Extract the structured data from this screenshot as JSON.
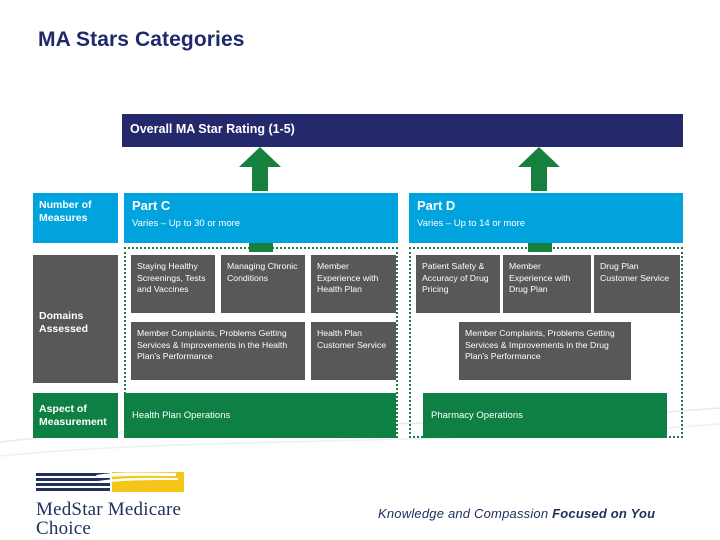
{
  "slide": {
    "title": "MA Stars Categories",
    "overall_bar": {
      "label": "Overall MA Star Rating (1-5)",
      "color": "#25286b"
    },
    "row_labels": [
      {
        "key": "measures",
        "label": "Number of Measures",
        "color": "#00a3dd"
      },
      {
        "key": "domains",
        "label": "Domains Assessed",
        "color": "#58585b"
      },
      {
        "key": "aspect",
        "label": "Aspect of Measurement",
        "color": "#0e8044"
      }
    ],
    "parts": {
      "part_c": {
        "name": "Part C",
        "measures": "Varies – Up to 30 or more",
        "domains_row1": [
          "Staying Healthy Screenings, Tests and Vaccines",
          "Managing Chronic Conditions",
          "Member Experience with Health Plan"
        ],
        "domains_row2": [
          "Member Complaints, Problems Getting Services & Improvements in the Health Plan's Performance",
          "Health Plan Customer Service"
        ],
        "aspect": "Health Plan Operations"
      },
      "part_d": {
        "name": "Part D",
        "measures": "Varies – Up to 14 or more",
        "domains_row1": [
          "Patient Safety & Accuracy of Drug Pricing",
          "Member Experience with Drug Plan",
          "Drug Plan Customer Service"
        ],
        "domains_row2": [
          "Member Complaints, Problems Getting Services & Improvements in the Drug Plan's Performance"
        ],
        "aspect": "Pharmacy Operations"
      }
    },
    "arrows": [
      {
        "name": "arrow-part-c",
        "color": "#16813f"
      },
      {
        "name": "arrow-part-d",
        "color": "#16813f"
      }
    ],
    "footer": {
      "logo_line1": "MedStar Medicare",
      "logo_line2": "Choice",
      "tagline_light": "Knowledge and Compassion ",
      "tagline_bold": "Focused on You",
      "brand_navy": "#22305e",
      "brand_yellow": "#f5c518"
    }
  }
}
